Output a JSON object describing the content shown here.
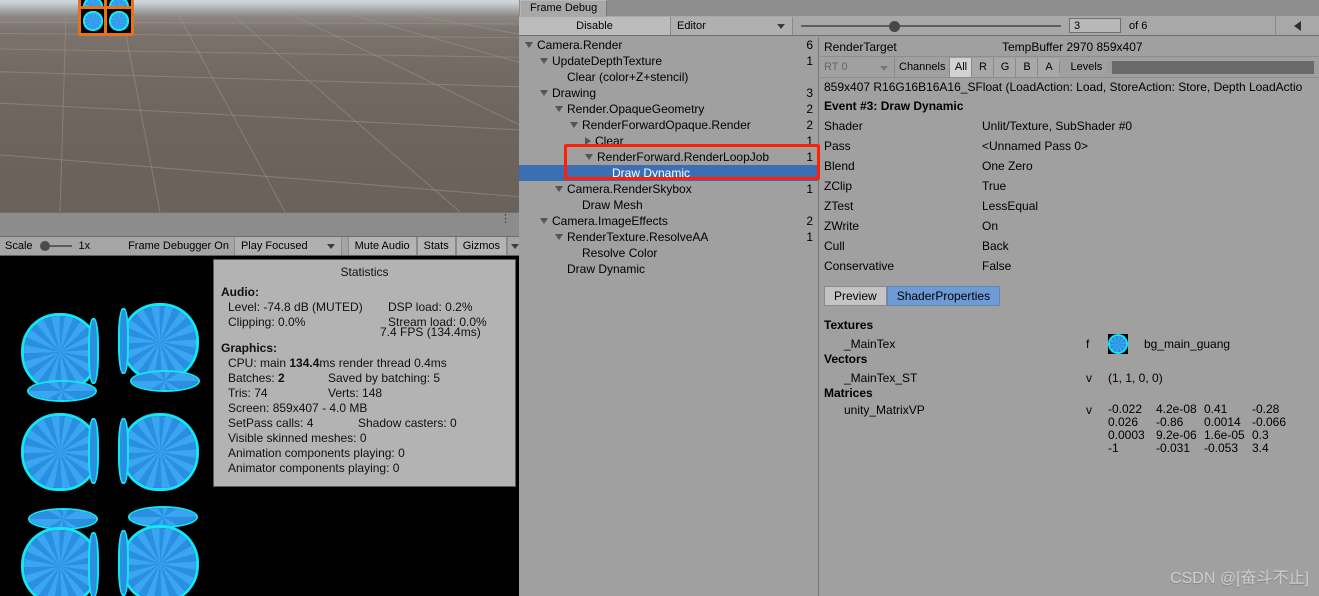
{
  "scene_view": {
    "selected_sprites": 4
  },
  "game_toolbar": {
    "scale_label": "Scale",
    "scale_value": "1x",
    "frame_debugger_label": "Frame Debugger On",
    "play_mode": "Play Focused",
    "mute_audio": "Mute Audio",
    "stats": "Stats",
    "gizmos": "Gizmos"
  },
  "statistics": {
    "title": "Statistics",
    "audio_header": "Audio:",
    "audio_level": "Level: -74.8 dB (MUTED)",
    "audio_clipping": "Clipping: 0.0%",
    "dsp_load": "DSP load: 0.2%",
    "stream_load": "Stream load: 0.0%",
    "graphics_header": "Graphics:",
    "fps": "7.4 FPS (134.4ms)",
    "cpu_pre": "CPU: main ",
    "cpu_main": "134.4",
    "cpu_post": "ms  render thread 0.4ms",
    "batches_label": "Batches: ",
    "batches_value": "2",
    "saved_by_batching": "Saved by batching: 5",
    "tris": "Tris: 74",
    "verts": "Verts: 148",
    "screen": "Screen: 859x407 - 4.0 MB",
    "setpass": "SetPass calls: 4",
    "shadow_casters": "Shadow casters: 0",
    "skinned_meshes": "Visible skinned meshes: 0",
    "animation_components": "Animation components playing: 0",
    "animator_components": "Animator components playing: 0"
  },
  "frame_debug": {
    "tab_label": "Frame Debug",
    "disable_button": "Disable",
    "target_dropdown": "Editor",
    "event_index": "3",
    "event_total_label": "of 6",
    "prev_button_icon": "arrow-left-icon",
    "tree": [
      {
        "label": "Camera.Render",
        "depth": 0,
        "tri": "down",
        "count": "6"
      },
      {
        "label": "UpdateDepthTexture",
        "depth": 1,
        "tri": "down",
        "count": "1"
      },
      {
        "label": "Clear (color+Z+stencil)",
        "depth": 2,
        "tri": "none",
        "count": ""
      },
      {
        "label": "Drawing",
        "depth": 1,
        "tri": "down",
        "count": "3"
      },
      {
        "label": "Render.OpaqueGeometry",
        "depth": 2,
        "tri": "down",
        "count": "2"
      },
      {
        "label": "RenderForwardOpaque.Render",
        "depth": 3,
        "tri": "down",
        "count": "2"
      },
      {
        "label": "Clear",
        "depth": 4,
        "tri": "right",
        "count": "1"
      },
      {
        "label": "RenderForward.RenderLoopJob",
        "depth": 4,
        "tri": "down",
        "count": "1"
      },
      {
        "label": "Draw Dynamic",
        "depth": 5,
        "tri": "none",
        "count": "",
        "selected": true
      },
      {
        "label": "Camera.RenderSkybox",
        "depth": 2,
        "tri": "down",
        "count": "1"
      },
      {
        "label": "Draw Mesh",
        "depth": 3,
        "tri": "none",
        "count": ""
      },
      {
        "label": "Camera.ImageEffects",
        "depth": 1,
        "tri": "down",
        "count": "2"
      },
      {
        "label": "RenderTexture.ResolveAA",
        "depth": 2,
        "tri": "down",
        "count": "1"
      },
      {
        "label": "Resolve Color",
        "depth": 3,
        "tri": "none",
        "count": ""
      },
      {
        "label": "Draw Dynamic",
        "depth": 2,
        "tri": "none",
        "count": ""
      }
    ],
    "detail": {
      "render_target_label": "RenderTarget",
      "render_target_value": "TempBuffer 2970 859x407",
      "rt_select": "RT 0",
      "channels_label": "Channels",
      "channels": [
        "All",
        "R",
        "G",
        "B",
        "A"
      ],
      "channel_active": "All",
      "levels_label": "Levels",
      "rt_description": "859x407 R16G16B16A16_SFloat (LoadAction: Load, StoreAction: Store, Depth LoadActio",
      "event_title": "Event #3: Draw Dynamic",
      "properties": [
        {
          "key": "Shader",
          "value": "Unlit/Texture, SubShader #0"
        },
        {
          "key": "Pass",
          "value": "<Unnamed Pass 0>"
        },
        {
          "key": "Blend",
          "value": "One Zero"
        },
        {
          "key": "ZClip",
          "value": "True"
        },
        {
          "key": "ZTest",
          "value": "LessEqual"
        },
        {
          "key": "ZWrite",
          "value": "On"
        },
        {
          "key": "Cull",
          "value": "Back"
        },
        {
          "key": "Conservative",
          "value": "False"
        }
      ],
      "preview_tab": "Preview",
      "shader_properties_tab": "ShaderProperties",
      "textures_header": "Textures",
      "texture_name": "_MainTex",
      "texture_type": "f",
      "texture_value": "bg_main_guang",
      "vectors_header": "Vectors",
      "vector_name": "_MainTex_ST",
      "vector_type": "v",
      "vector_value": "(1, 1, 0, 0)",
      "matrices_header": "Matrices",
      "matrix_name": "unity_MatrixVP",
      "matrix_type": "v",
      "matrix_rows": [
        [
          "-0.022",
          "4.2e-08",
          "0.41",
          "-0.28"
        ],
        [
          "0.026",
          "-0.86",
          "0.0014",
          "-0.066"
        ],
        [
          "0.0003",
          "9.2e-06",
          "1.6e-05",
          "0.3"
        ],
        [
          "-1",
          "-0.031",
          "-0.053",
          "3.4"
        ]
      ]
    }
  },
  "watermark": "CSDN @[奋斗不止]",
  "colors": {
    "selection_blue": "#3c6eb4",
    "highlight_red": "#ff1f09",
    "panel_gray": "#a0a0a0",
    "accent_tab": "#6e9ad6"
  }
}
